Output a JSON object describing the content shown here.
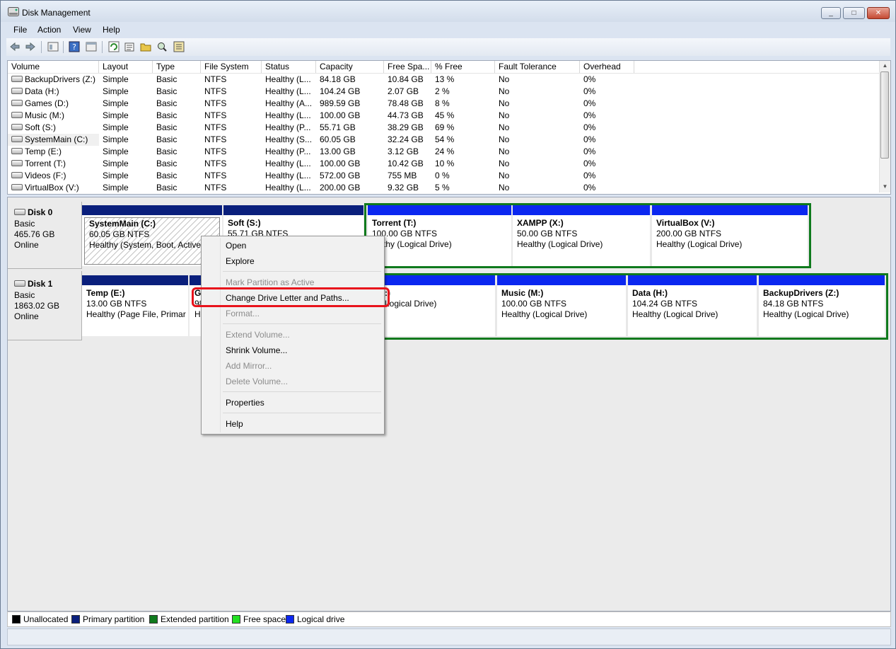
{
  "window": {
    "title": "Disk Management",
    "min": "_",
    "max": "□",
    "close": "✕"
  },
  "menu": [
    "File",
    "Action",
    "View",
    "Help"
  ],
  "toolbar": [
    "back-icon",
    "forward-icon",
    "properties-icon",
    "help-icon",
    "console-icon",
    "refresh-icon",
    "properties-sheet-icon",
    "open-folder-icon",
    "search-volume-icon",
    "settings-icon"
  ],
  "columns": [
    "Volume",
    "Layout",
    "Type",
    "File System",
    "Status",
    "Capacity",
    "Free Spa...",
    "% Free",
    "Fault Tolerance",
    "Overhead"
  ],
  "volumes": [
    {
      "name": "BackupDrivers (Z:)",
      "layout": "Simple",
      "type": "Basic",
      "fs": "NTFS",
      "status": "Healthy (L...",
      "capacity": "84.18 GB",
      "free": "10.84 GB",
      "pct": "13 %",
      "fault": "No",
      "overhead": "0%"
    },
    {
      "name": "Data (H:)",
      "layout": "Simple",
      "type": "Basic",
      "fs": "NTFS",
      "status": "Healthy (L...",
      "capacity": "104.24 GB",
      "free": "2.07 GB",
      "pct": "2 %",
      "fault": "No",
      "overhead": "0%"
    },
    {
      "name": "Games (D:)",
      "layout": "Simple",
      "type": "Basic",
      "fs": "NTFS",
      "status": "Healthy (A...",
      "capacity": "989.59 GB",
      "free": "78.48 GB",
      "pct": "8 %",
      "fault": "No",
      "overhead": "0%"
    },
    {
      "name": "Music (M:)",
      "layout": "Simple",
      "type": "Basic",
      "fs": "NTFS",
      "status": "Healthy (L...",
      "capacity": "100.00 GB",
      "free": "44.73 GB",
      "pct": "45 %",
      "fault": "No",
      "overhead": "0%"
    },
    {
      "name": "Soft (S:)",
      "layout": "Simple",
      "type": "Basic",
      "fs": "NTFS",
      "status": "Healthy (P...",
      "capacity": "55.71 GB",
      "free": "38.29 GB",
      "pct": "69 %",
      "fault": "No",
      "overhead": "0%"
    },
    {
      "name": "SystemMain (C:)",
      "layout": "Simple",
      "type": "Basic",
      "fs": "NTFS",
      "status": "Healthy (S...",
      "capacity": "60.05 GB",
      "free": "32.24 GB",
      "pct": "54 %",
      "fault": "No",
      "overhead": "0%"
    },
    {
      "name": "Temp (E:)",
      "layout": "Simple",
      "type": "Basic",
      "fs": "NTFS",
      "status": "Healthy (P...",
      "capacity": "13.00 GB",
      "free": "3.12 GB",
      "pct": "24 %",
      "fault": "No",
      "overhead": "0%"
    },
    {
      "name": "Torrent (T:)",
      "layout": "Simple",
      "type": "Basic",
      "fs": "NTFS",
      "status": "Healthy (L...",
      "capacity": "100.00 GB",
      "free": "10.42 GB",
      "pct": "10 %",
      "fault": "No",
      "overhead": "0%"
    },
    {
      "name": "Videos (F:)",
      "layout": "Simple",
      "type": "Basic",
      "fs": "NTFS",
      "status": "Healthy (L...",
      "capacity": "572.00 GB",
      "free": "755 MB",
      "pct": "0 %",
      "fault": "No",
      "overhead": "0%"
    },
    {
      "name": "VirtualBox (V:)",
      "layout": "Simple",
      "type": "Basic",
      "fs": "NTFS",
      "status": "Healthy (L...",
      "capacity": "200.00 GB",
      "free": "9.32 GB",
      "pct": "5 %",
      "fault": "No",
      "overhead": "0%"
    }
  ],
  "disk0": {
    "name": "Disk 0",
    "type": "Basic",
    "size": "465.76 GB",
    "state": "Online",
    "parts": [
      {
        "name": "SystemMain  (C:)",
        "size": "60.05 GB NTFS",
        "status": "Healthy (System, Boot, Active, P"
      },
      {
        "name": "Soft  (S:)",
        "size": "55.71 GB NTFS",
        "status": ""
      },
      {
        "name": "Torrent  (T:)",
        "size": "100.00 GB NTFS",
        "status": "ealthy (Logical Drive)"
      },
      {
        "name": "XAMPP  (X:)",
        "size": "50.00 GB NTFS",
        "status": "Healthy (Logical Drive)"
      },
      {
        "name": "VirtualBox  (V:)",
        "size": "200.00 GB NTFS",
        "status": "Healthy (Logical Drive)"
      }
    ]
  },
  "disk1": {
    "name": "Disk 1",
    "type": "Basic",
    "size": "1863.02 GB",
    "state": "Online",
    "parts": [
      {
        "name": "Temp  (E:)",
        "size": "13.00 GB NTFS",
        "status": "Healthy (Page File, Primar"
      },
      {
        "name": "G",
        "size": "98",
        "status": "H"
      },
      {
        "name": ":)",
        "size": "",
        "status": "Logical Drive)"
      },
      {
        "name": "Music  (M:)",
        "size": "100.00 GB NTFS",
        "status": "Healthy (Logical Drive)"
      },
      {
        "name": "Data  (H:)",
        "size": "104.24 GB NTFS",
        "status": "Healthy (Logical Drive)"
      },
      {
        "name": "BackupDrivers  (Z:)",
        "size": "84.18 GB NTFS",
        "status": "Healthy (Logical Drive)"
      }
    ]
  },
  "legend": [
    {
      "label": "Unallocated",
      "color": "#000000"
    },
    {
      "label": "Primary partition",
      "color": "#0a1f7c"
    },
    {
      "label": "Extended partition",
      "color": "#0f7a1d"
    },
    {
      "label": "Free space",
      "color": "#22e022"
    },
    {
      "label": "Logical drive",
      "color": "#0b27f0"
    }
  ],
  "context_menu": {
    "open": "Open",
    "explore": "Explore",
    "mark_active": "Mark Partition as Active",
    "change_letter": "Change Drive Letter and Paths...",
    "format": "Format...",
    "extend": "Extend Volume...",
    "shrink": "Shrink Volume...",
    "add_mirror": "Add Mirror...",
    "delete": "Delete Volume...",
    "properties": "Properties",
    "help": "Help"
  }
}
